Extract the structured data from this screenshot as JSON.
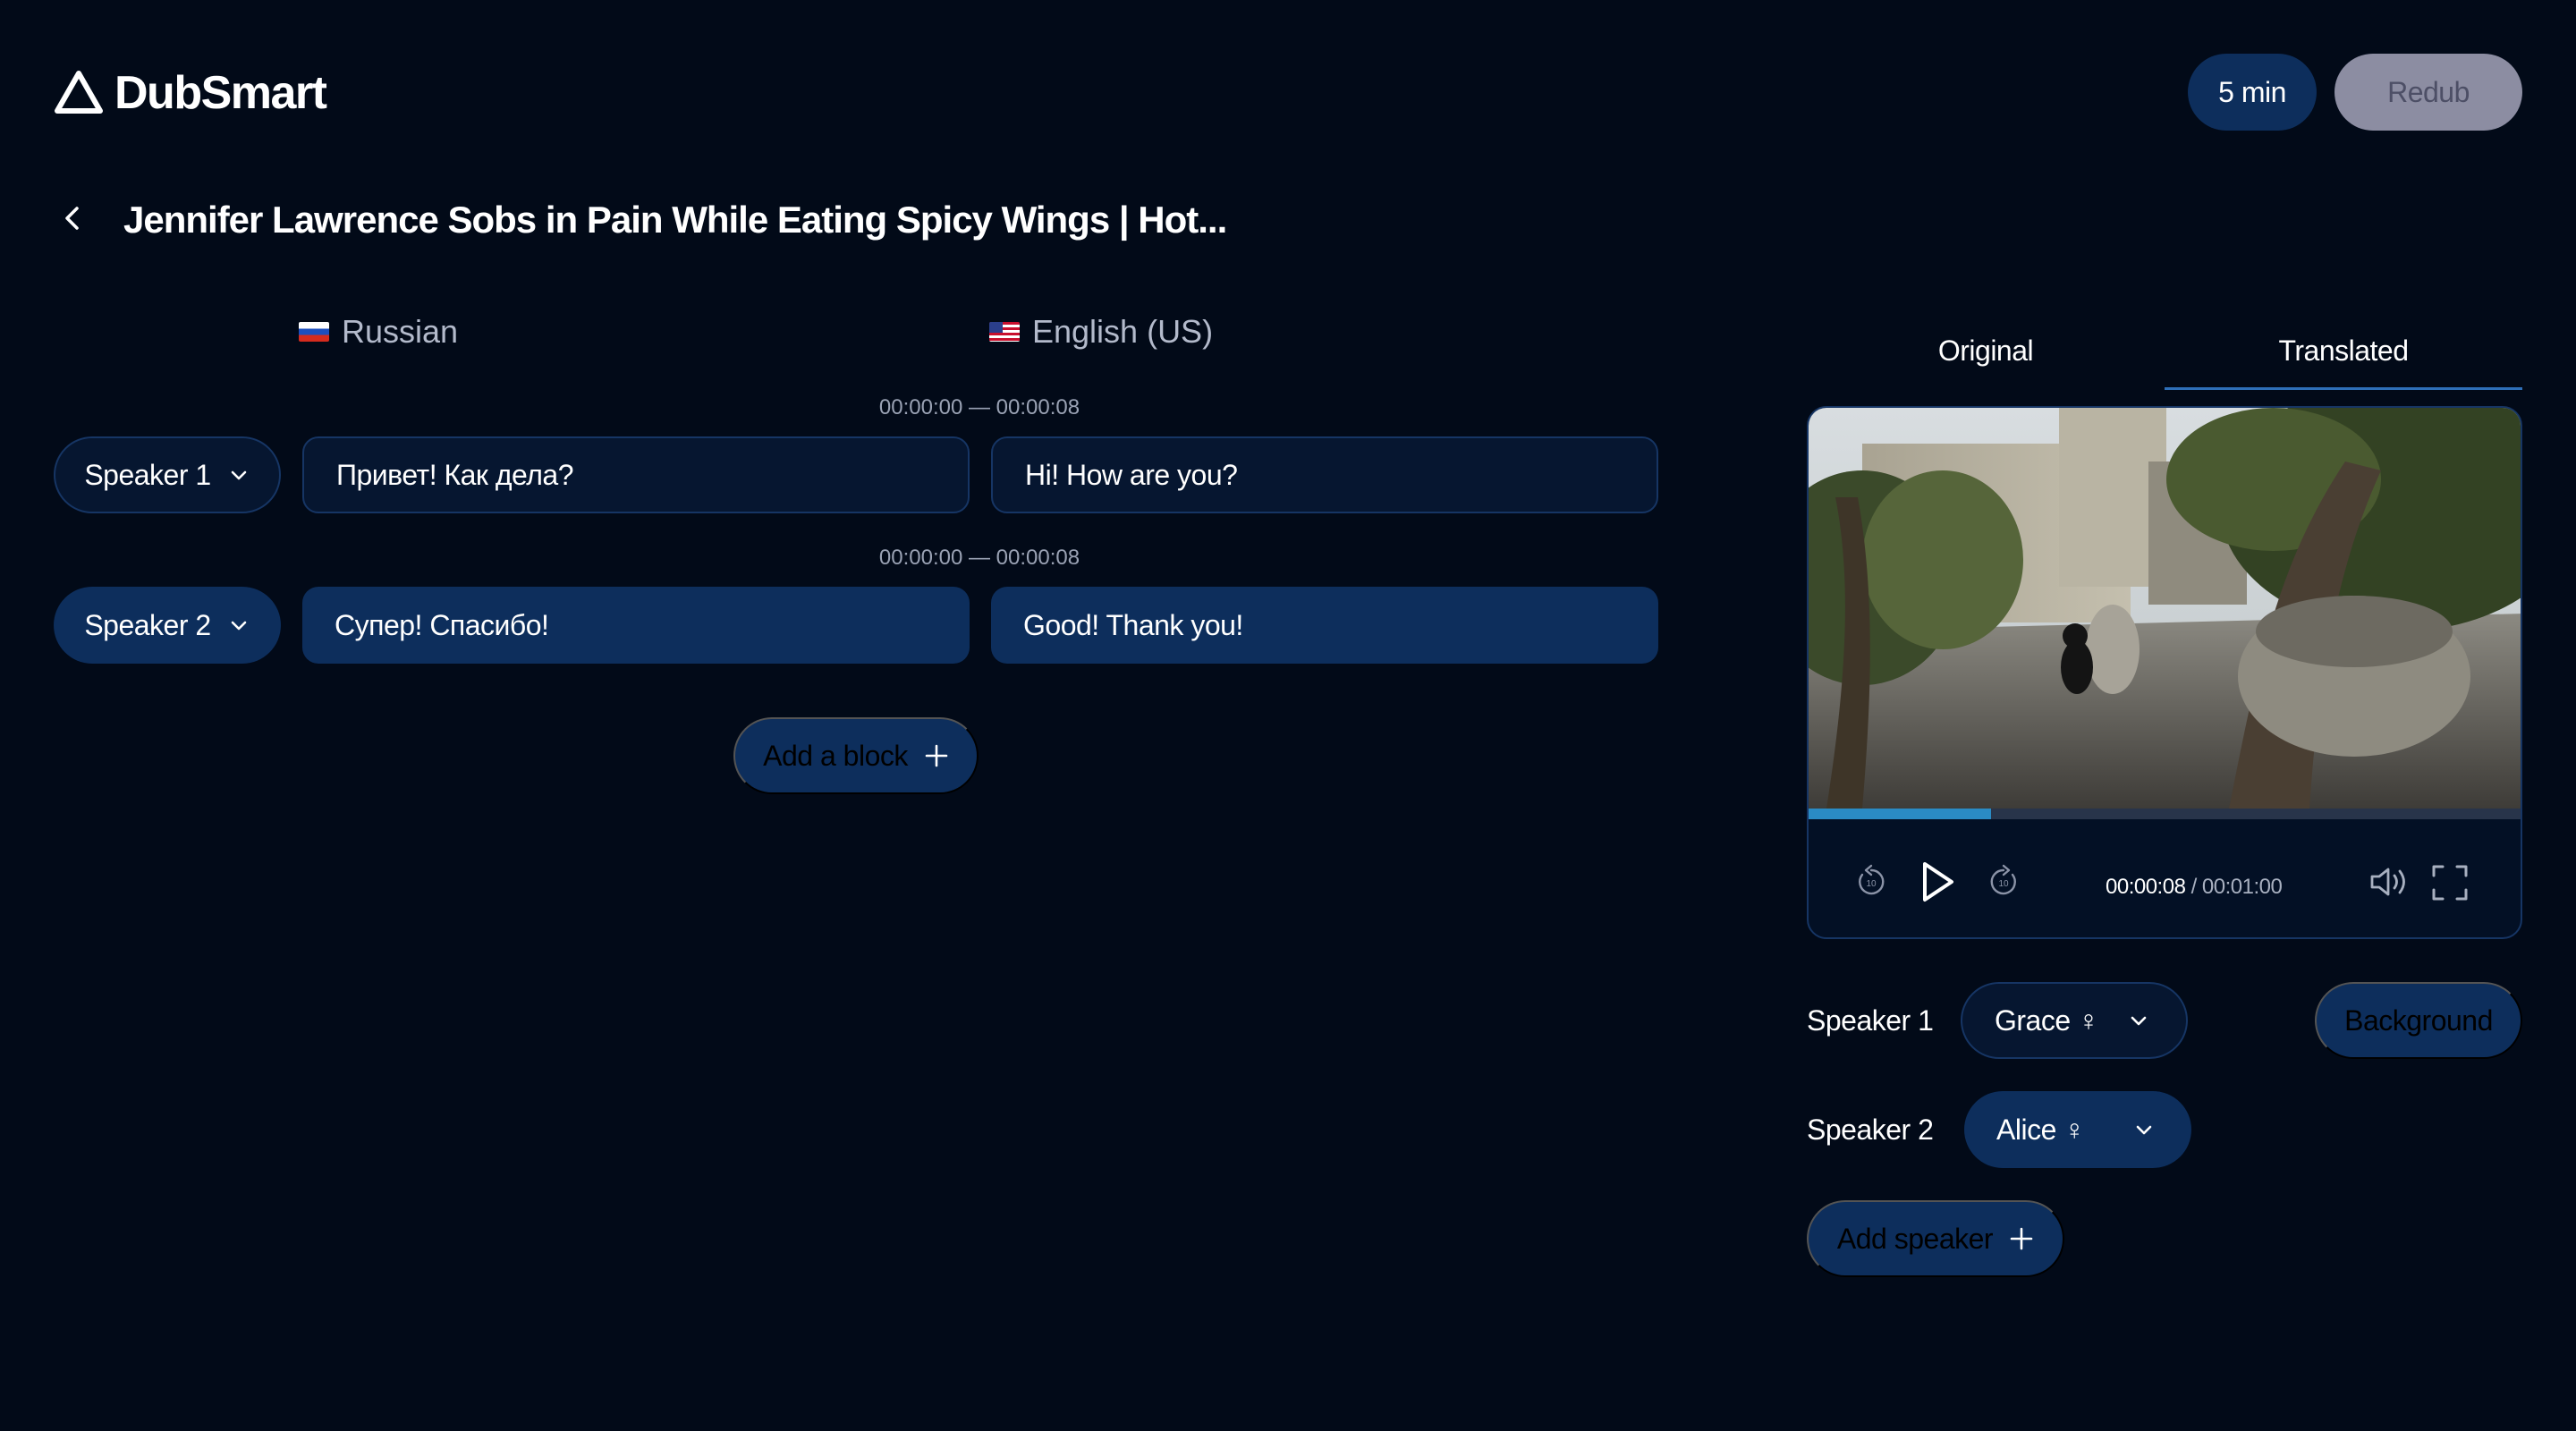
{
  "app": {
    "name": "DubSmart"
  },
  "header": {
    "minutes_label": "5 min",
    "redub_label": "Redub"
  },
  "project": {
    "title": "Jennifer Lawrence Sobs in Pain While Eating Spicy Wings | Hot..."
  },
  "languages": {
    "source": "Russian",
    "target": "English (US)"
  },
  "blocks": [
    {
      "timecode": "00:00:00 — 00:00:08",
      "speaker": "Speaker 1",
      "source_text": "Привет! Как дела?",
      "target_text": "Hi! How are you?"
    },
    {
      "timecode": "00:00:00 — 00:00:08",
      "speaker": "Speaker 2",
      "source_text": "Супер! Спасибо!",
      "target_text": "Good! Thank you!"
    }
  ],
  "add_block_label": "Add a block",
  "preview": {
    "tabs": [
      "Original",
      "Translated"
    ],
    "active_tab": "Translated",
    "current_time": "00:00:08",
    "duration": "/ 00:01:00",
    "progress": 0.255
  },
  "voices": [
    {
      "speaker": "Speaker 1",
      "voice": "Grace ♀"
    },
    {
      "speaker": "Speaker 2",
      "voice": "Alice ♀"
    }
  ],
  "background_label": "Background",
  "add_speaker_label": "Add speaker",
  "colors": {
    "bg": "#020a18",
    "accent": "#0d2e5c",
    "progress": "#2a8bc4"
  }
}
